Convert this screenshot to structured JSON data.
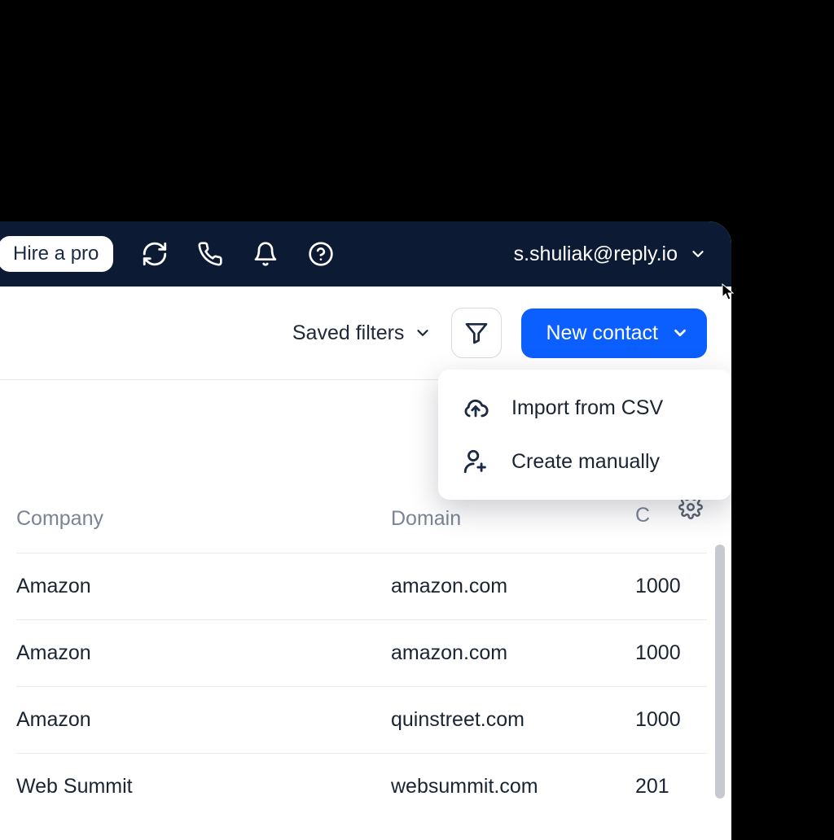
{
  "topbar": {
    "hire_label": "Hire a pro",
    "user_email": "s.shuliak@reply.io"
  },
  "toolbar": {
    "saved_filters_label": "Saved filters",
    "new_contact_label": "New contact"
  },
  "dropdown": {
    "import_csv_label": "Import from CSV",
    "create_manually_label": "Create manually"
  },
  "table": {
    "headers": {
      "company": "Company",
      "domain": "Domain",
      "count_prefix": "C"
    },
    "rows": [
      {
        "company": "Amazon",
        "domain": "amazon.com",
        "count": "1000"
      },
      {
        "company": "Amazon",
        "domain": "amazon.com",
        "count": "1000"
      },
      {
        "company": "Amazon",
        "domain": "quinstreet.com",
        "count": "1000"
      },
      {
        "company": "Web Summit",
        "domain": "websummit.com",
        "count": "201"
      }
    ]
  }
}
